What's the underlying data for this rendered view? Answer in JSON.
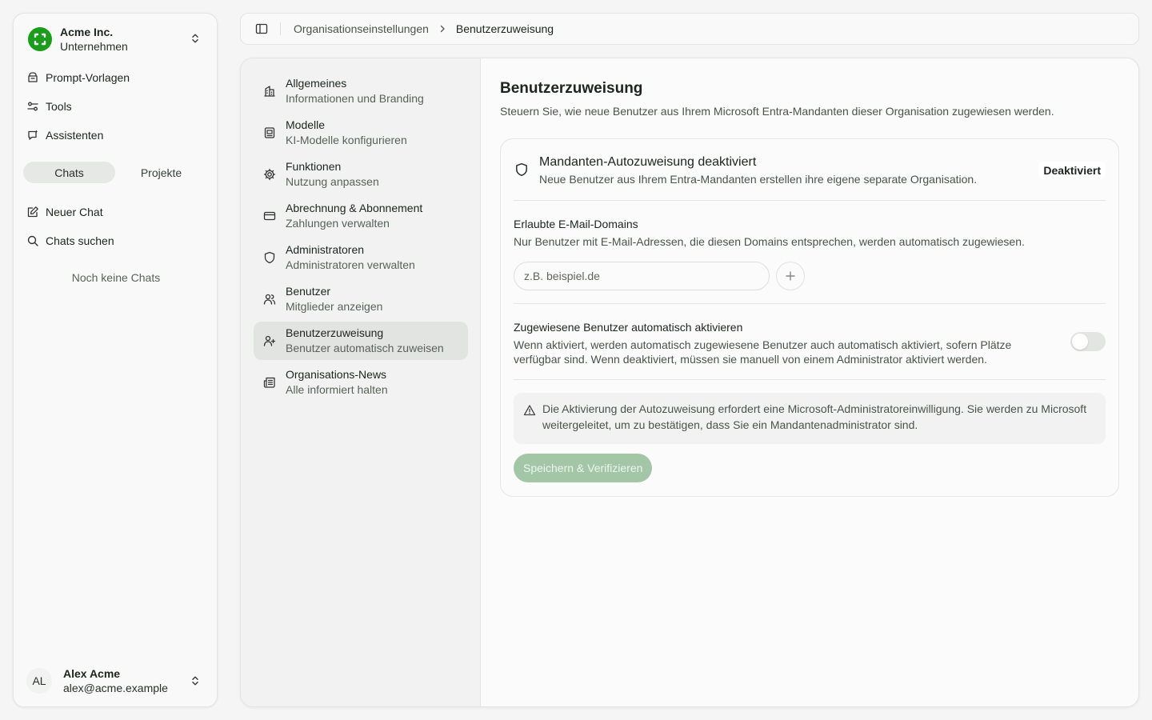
{
  "org": {
    "name": "Acme Inc.",
    "type": "Unternehmen"
  },
  "sidebar": {
    "nav": [
      {
        "label": "Prompt-Vorlagen",
        "icon": "prompt-template-icon"
      },
      {
        "label": "Tools",
        "icon": "tools-icon"
      },
      {
        "label": "Assistenten",
        "icon": "assistant-icon"
      }
    ],
    "tabs": [
      {
        "label": "Chats",
        "active": true
      },
      {
        "label": "Projekte",
        "active": false
      }
    ],
    "actions": [
      {
        "label": "Neuer Chat",
        "icon": "new-chat-icon"
      },
      {
        "label": "Chats suchen",
        "icon": "search-icon"
      }
    ],
    "empty_text": "Noch keine Chats"
  },
  "user": {
    "initials": "AL",
    "name": "Alex Acme",
    "email": "alex@acme.example"
  },
  "breadcrumb": {
    "parent": "Organisationseinstellungen",
    "current": "Benutzerzuweisung"
  },
  "settings_nav": [
    {
      "title": "Allgemeines",
      "desc": "Informationen und Branding",
      "icon": "building-icon",
      "active": false
    },
    {
      "title": "Modelle",
      "desc": "KI-Modelle konfigurieren",
      "icon": "model-icon",
      "active": false
    },
    {
      "title": "Funktionen",
      "desc": "Nutzung anpassen",
      "icon": "gear-icon",
      "active": false
    },
    {
      "title": "Abrechnung & Abonnement",
      "desc": "Zahlungen verwalten",
      "icon": "credit-card-icon",
      "active": false
    },
    {
      "title": "Administratoren",
      "desc": "Administratoren verwalten",
      "icon": "shield-icon",
      "active": false
    },
    {
      "title": "Benutzer",
      "desc": "Mitglieder anzeigen",
      "icon": "users-icon",
      "active": false
    },
    {
      "title": "Benutzerzuweisung",
      "desc": "Benutzer automatisch zuweisen",
      "icon": "user-plus-icon",
      "active": true
    },
    {
      "title": "Organisations-News",
      "desc": "Alle informiert halten",
      "icon": "newspaper-icon",
      "active": false
    }
  ],
  "page": {
    "title": "Benutzerzuweisung",
    "description": "Steuern Sie, wie neue Benutzer aus Ihrem Microsoft Entra-Mandanten dieser Organisation zugewiesen werden."
  },
  "status": {
    "title": "Mandanten-Autozuweisung deaktiviert",
    "description": "Neue Benutzer aus Ihrem Entra-Mandanten erstellen ihre eigene separate Organisation.",
    "badge": "Deaktiviert"
  },
  "domains": {
    "title": "Erlaubte E-Mail-Domains",
    "description": "Nur Benutzer mit E-Mail-Adressen, die diesen Domains entsprechen, werden automatisch zugewiesen.",
    "placeholder": "z.B. beispiel.de",
    "value": ""
  },
  "auto_activate": {
    "title": "Zugewiesene Benutzer automatisch aktivieren",
    "description": "Wenn aktiviert, werden automatisch zugewiesene Benutzer auch automatisch aktiviert, sofern Plätze verfügbar sind. Wenn deaktiviert, müssen sie manuell von einem Administrator aktiviert werden.",
    "enabled": false
  },
  "alert": {
    "text": "Die Aktivierung der Autozuweisung erfordert eine Microsoft-Administratoreinwilligung. Sie werden zu Microsoft weitergeleitet, um zu bestätigen, dass Sie ein Mandantenadministrator sind."
  },
  "save_button": {
    "label": "Speichern & Verifizieren",
    "enabled": false
  },
  "colors": {
    "accent": "#1a9d1a",
    "save_disabled": "#a3c6a6",
    "active_nav": "#e1e4e1"
  }
}
